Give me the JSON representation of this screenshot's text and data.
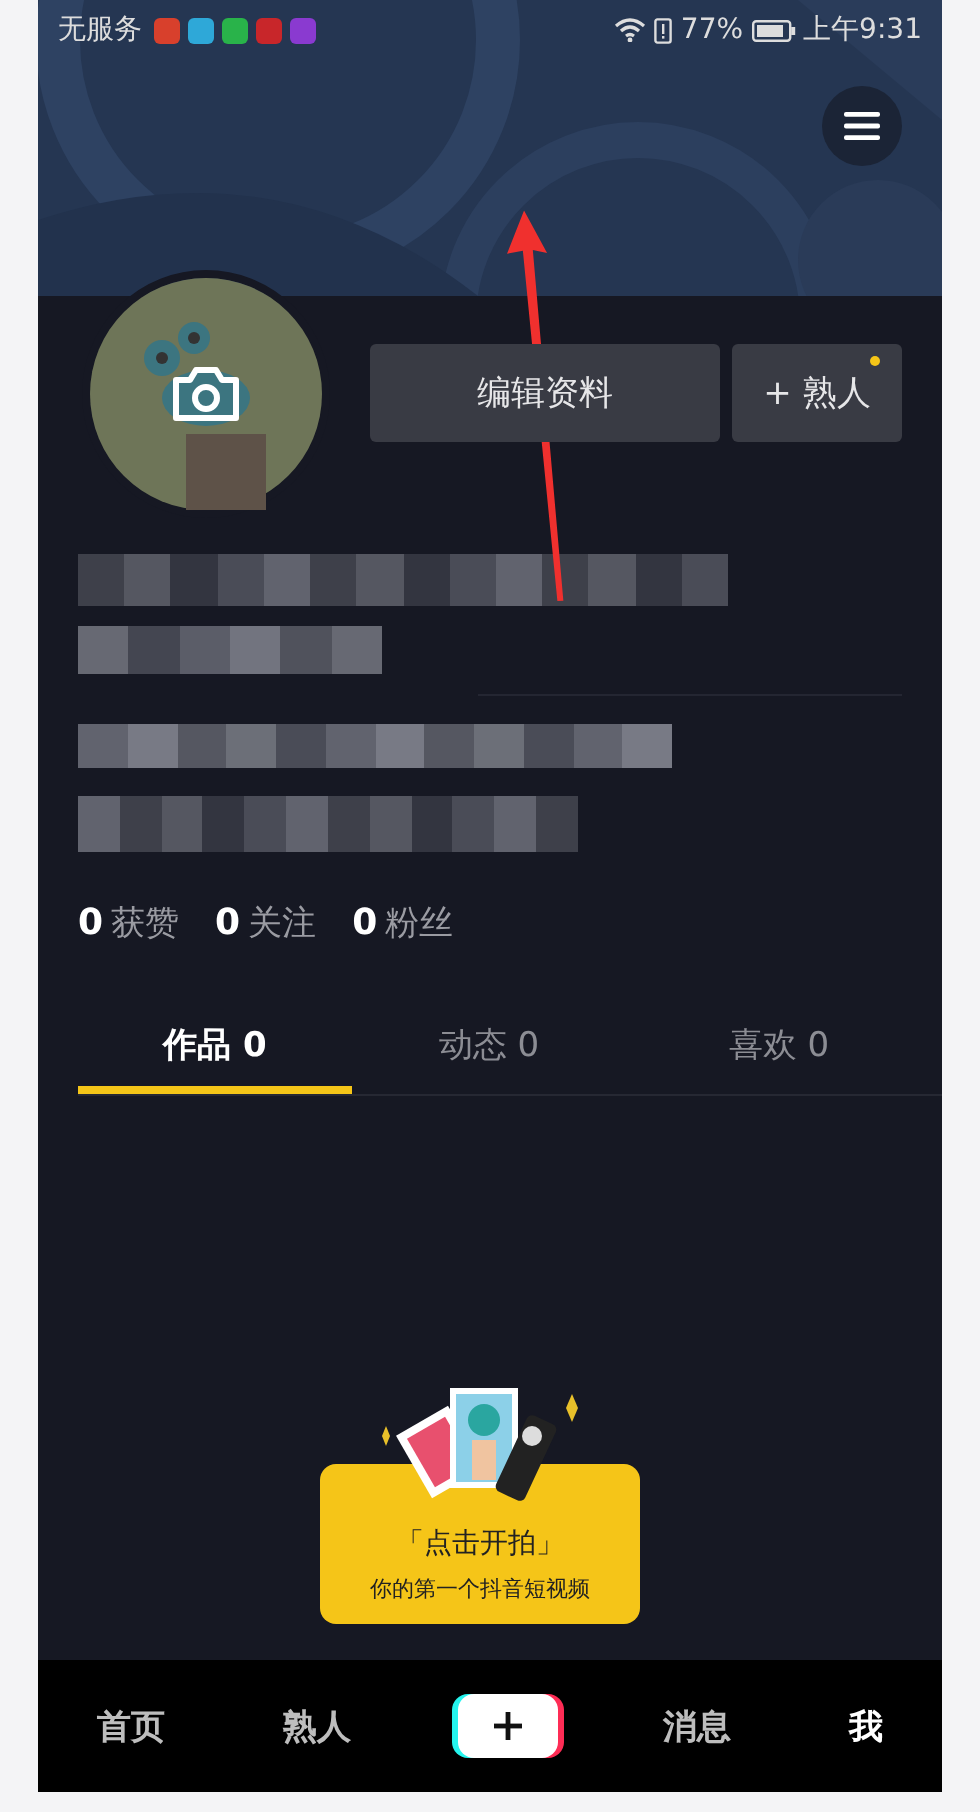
{
  "status_bar": {
    "carrier": "无服务",
    "battery_percent": "77%",
    "time": "上午9:31"
  },
  "profile": {
    "edit_button": "编辑资料",
    "friend_button": "+ 熟人",
    "friend_badge": true
  },
  "stats": [
    {
      "count": "0",
      "label": "获赞"
    },
    {
      "count": "0",
      "label": "关注"
    },
    {
      "count": "0",
      "label": "粉丝"
    }
  ],
  "tabs": [
    {
      "label": "作品 0",
      "selected": true
    },
    {
      "label": "动态 0",
      "selected": false
    },
    {
      "label": "喜欢 0",
      "selected": false
    }
  ],
  "prompt": {
    "title": "「点击开拍」",
    "subtitle": "你的第一个抖音短视频"
  },
  "nav": [
    {
      "label": "首页",
      "kind": "text",
      "selected": false
    },
    {
      "label": "熟人",
      "kind": "text",
      "selected": false
    },
    {
      "kind": "create"
    },
    {
      "label": "消息",
      "kind": "text",
      "selected": false
    },
    {
      "label": "我",
      "kind": "text",
      "selected": true
    }
  ]
}
